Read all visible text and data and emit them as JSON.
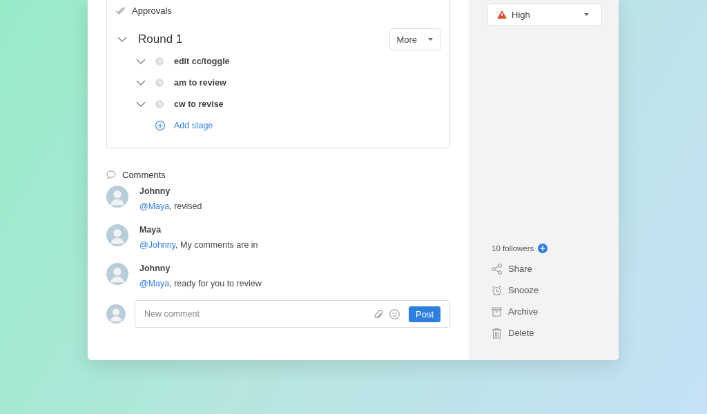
{
  "approvals": {
    "title": "Approvals",
    "round": {
      "title": "Round 1",
      "menu": "More",
      "stages": [
        {
          "label": "edit cc/toggle"
        },
        {
          "label": "am to review"
        },
        {
          "label": "cw to revise"
        }
      ],
      "add_label": "Add stage"
    }
  },
  "comments": {
    "title": "Comments",
    "items": [
      {
        "author": "Johnny",
        "mention": "@Maya",
        "text": ", revised"
      },
      {
        "author": "Maya",
        "mention": "@Johnny",
        "text": ", My comments are in"
      },
      {
        "author": "Johnny",
        "mention": "@Maya",
        "text": ", ready for you to review"
      }
    ],
    "composer": {
      "placeholder": "New comment",
      "button": "Post"
    }
  },
  "sidebar": {
    "priority": "High",
    "followers": "10 followers",
    "actions": [
      {
        "kind": "share",
        "label": "Share"
      },
      {
        "kind": "snooze",
        "label": "Snooze"
      },
      {
        "kind": "archive",
        "label": "Archive"
      },
      {
        "kind": "delete",
        "label": "Delete"
      }
    ]
  }
}
